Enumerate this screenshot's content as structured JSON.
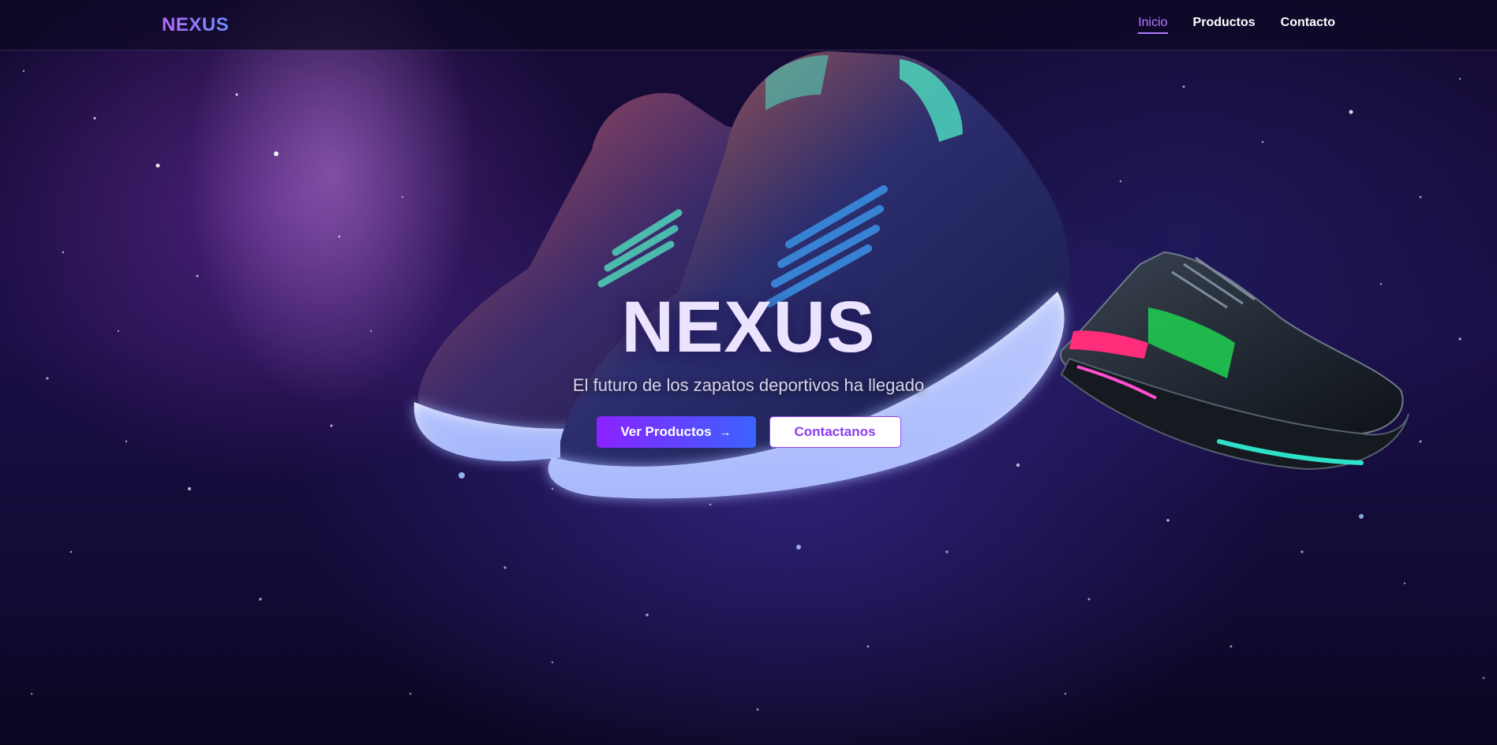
{
  "brand": {
    "logo": "NEXUS"
  },
  "nav": {
    "items": [
      {
        "label": "Inicio",
        "active": true
      },
      {
        "label": "Productos",
        "active": false
      },
      {
        "label": "Contacto",
        "active": false
      }
    ]
  },
  "hero": {
    "title": "NEXUS",
    "subtitle": "El futuro de los zapatos deportivos ha llegado",
    "primary_button": {
      "label": "Ver Productos",
      "icon": "arrow-right-icon"
    },
    "secondary_button": {
      "label": "Contactanos"
    }
  },
  "colors": {
    "accent_purple": "#8a22ff",
    "accent_blue": "#3a63ff",
    "nav_active": "#b27cff",
    "background": "#140a32"
  }
}
